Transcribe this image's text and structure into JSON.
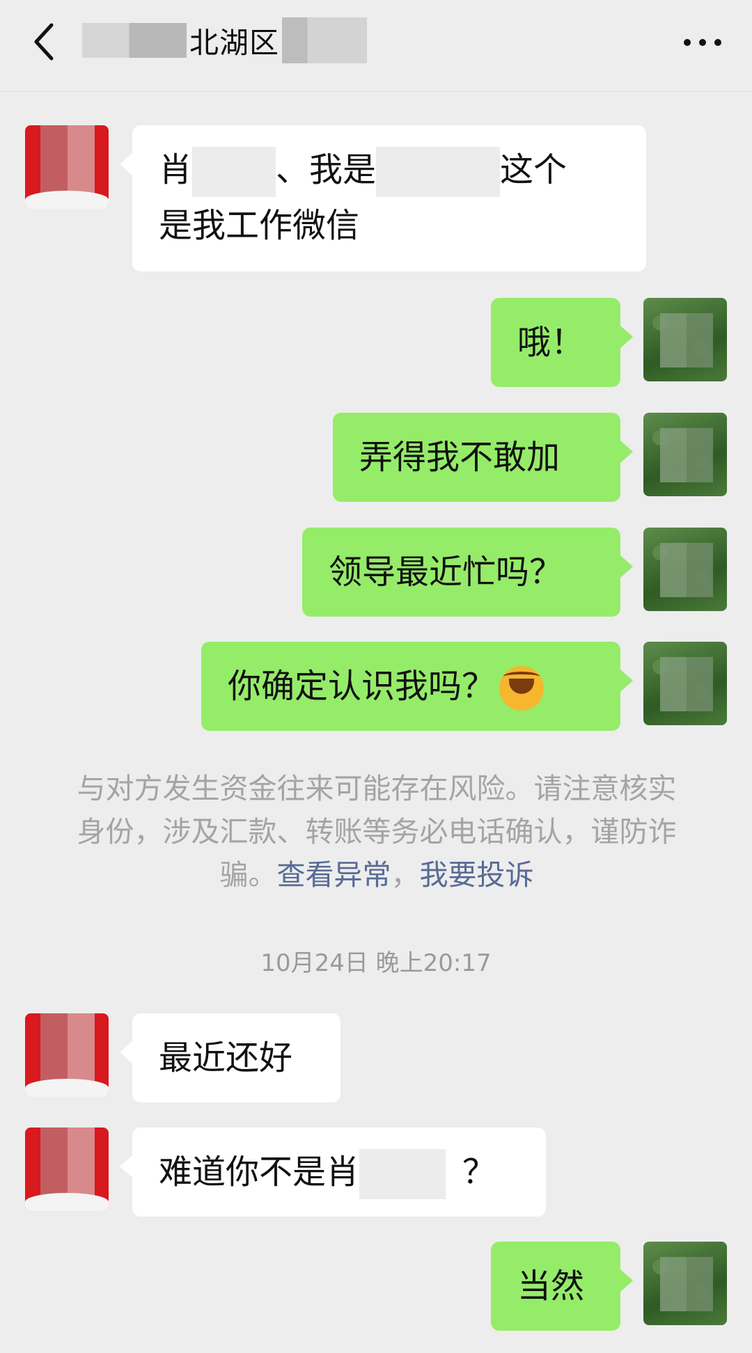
{
  "header": {
    "title": "北湖区"
  },
  "messages": [
    {
      "side": "left",
      "part1": "肖",
      "part2": "、我是",
      "part3": "这个",
      "line2": "是我工作微信"
    },
    {
      "side": "right",
      "text": "哦！"
    },
    {
      "side": "right",
      "text": "弄得我不敢加"
    },
    {
      "side": "right",
      "text": "领导最近忙吗？"
    },
    {
      "side": "right",
      "text": "你确定认识我吗？",
      "emoji": "face-with-tears-of-joy-emoji"
    },
    {
      "side": "left",
      "text": "最近还好"
    },
    {
      "side": "left",
      "part1": "难道你不是肖",
      "part2": "？"
    },
    {
      "side": "right",
      "text": "当然"
    }
  ],
  "notice": {
    "text": "与对方发生资金往来可能存在风险。请注意核实身份，涉及汇款、转账等务必电话确认，谨防诈骗。",
    "link_check": "查看异常",
    "separator": "，",
    "link_report": "我要投诉"
  },
  "timestamp": "10月24日 晚上20:17",
  "colors": {
    "background": "#ededed",
    "bubble_right": "#95ec69",
    "bubble_left": "#ffffff",
    "link": "#576b95"
  }
}
